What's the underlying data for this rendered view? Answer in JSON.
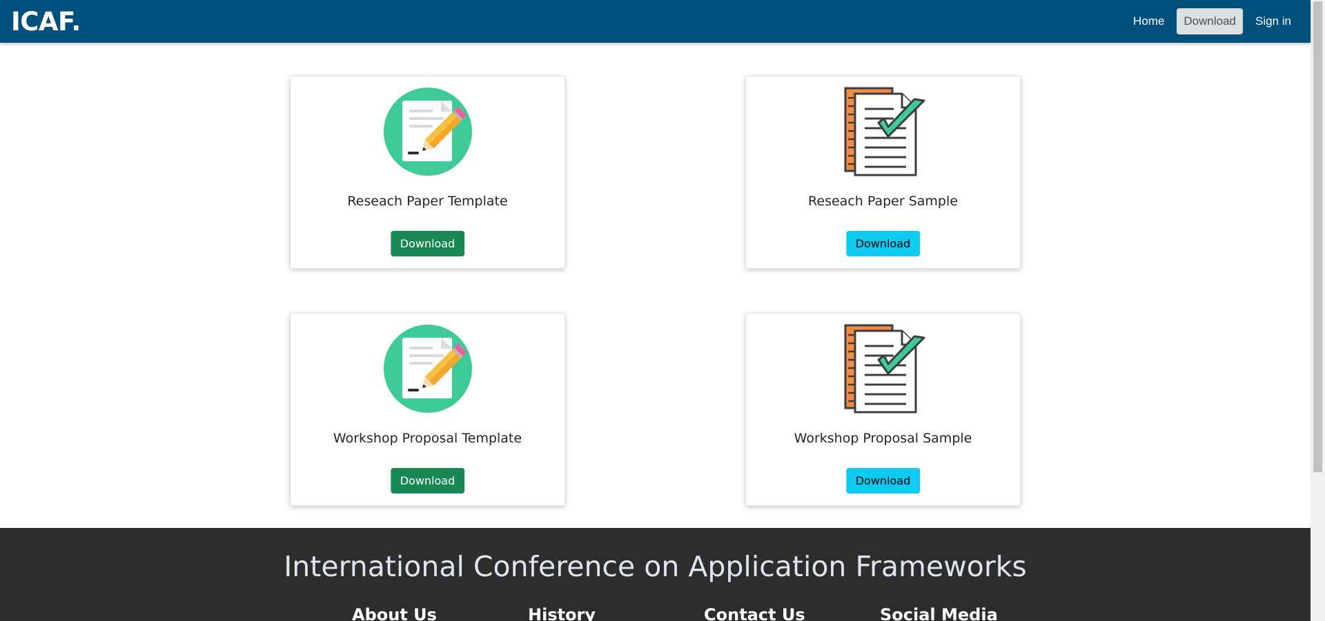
{
  "navbar": {
    "brand": "ICAF.",
    "links": [
      {
        "label": "Home"
      },
      {
        "label": "Download"
      },
      {
        "label": "Sign in"
      }
    ]
  },
  "cards": [
    {
      "title": "Reseach Paper Template",
      "button": "Download",
      "icon": "pencil-document-icon",
      "button_color": "#198754"
    },
    {
      "title": "Reseach Paper Sample",
      "button": "Download",
      "icon": "checklist-document-icon",
      "button_color": "#0dcaf0"
    },
    {
      "title": "Workshop Proposal Template",
      "button": "Download",
      "icon": "pencil-document-icon",
      "button_color": "#198754"
    },
    {
      "title": "Workshop Proposal Sample",
      "button": "Download",
      "icon": "checklist-document-icon",
      "button_color": "#0dcaf0"
    }
  ],
  "footer": {
    "title": "International Conference on Application Frameworks",
    "columns": [
      "About Us",
      "History",
      "Contact Us",
      "Social Media"
    ]
  },
  "colors": {
    "navbar_bg": "#00507e",
    "footer_bg": "#2d2d2d",
    "icon_green": "#3ecb97",
    "icon_orange": "#f08b45"
  }
}
